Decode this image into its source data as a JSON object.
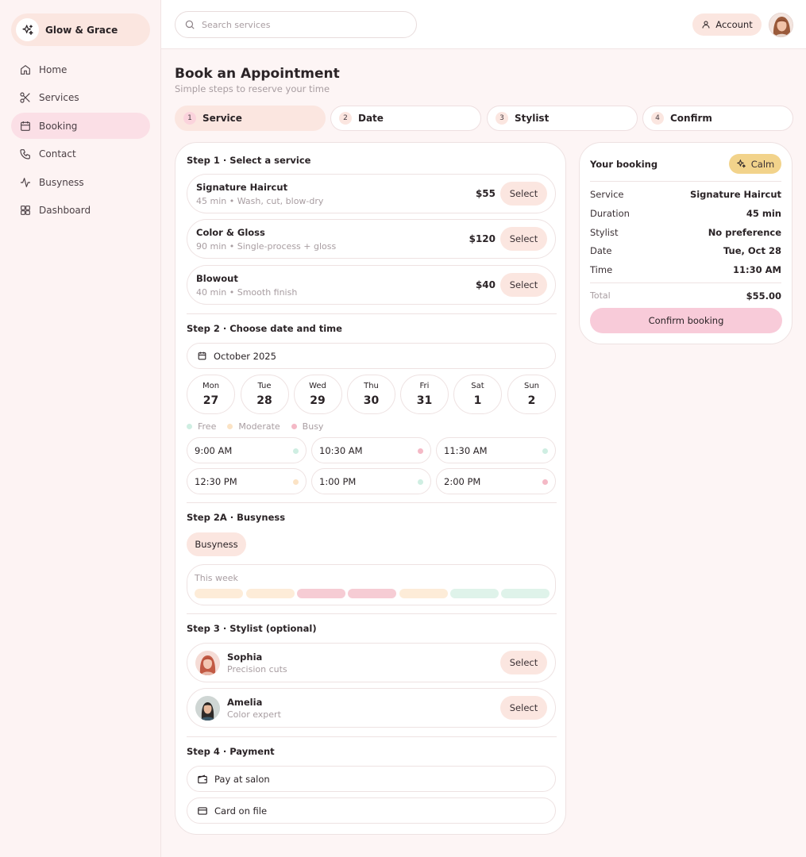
{
  "brand": {
    "name": "Glow & Grace"
  },
  "sidebar": {
    "items": [
      {
        "label": "Home",
        "icon": "home-icon"
      },
      {
        "label": "Services",
        "icon": "scissors-icon"
      },
      {
        "label": "Booking",
        "icon": "calendar-icon",
        "active": true
      },
      {
        "label": "Contact",
        "icon": "phone-icon"
      },
      {
        "label": "Busyness",
        "icon": "activity-icon"
      },
      {
        "label": "Dashboard",
        "icon": "dashboard-icon"
      }
    ]
  },
  "topbar": {
    "search_placeholder": "Search services",
    "account_label": "Account"
  },
  "page": {
    "title": "Book an Appointment",
    "subtitle": "Simple steps to reserve your time"
  },
  "steps": [
    {
      "num": "1",
      "label": "Service",
      "active": true
    },
    {
      "num": "2",
      "label": "Date"
    },
    {
      "num": "3",
      "label": "Stylist"
    },
    {
      "num": "4",
      "label": "Confirm"
    }
  ],
  "step1": {
    "title": "Step 1 · Select a service",
    "services": [
      {
        "name": "Signature Haircut",
        "meta": "45 min • Wash, cut, blow-dry",
        "price": "$55",
        "button": "Select"
      },
      {
        "name": "Color & Gloss",
        "meta": "90 min • Single-process + gloss",
        "price": "$120",
        "button": "Select"
      },
      {
        "name": "Blowout",
        "meta": "40 min • Smooth finish",
        "price": "$40",
        "button": "Select"
      }
    ]
  },
  "step2": {
    "title": "Step 2 · Choose date and time",
    "month": "October 2025",
    "days": [
      {
        "name": "Mon",
        "num": "27"
      },
      {
        "name": "Tue",
        "num": "28"
      },
      {
        "name": "Wed",
        "num": "29"
      },
      {
        "name": "Thu",
        "num": "30"
      },
      {
        "name": "Fri",
        "num": "31"
      },
      {
        "name": "Sat",
        "num": "1"
      },
      {
        "name": "Sun",
        "num": "2"
      }
    ],
    "legend": {
      "free": "Free",
      "moderate": "Moderate",
      "busy": "Busy"
    },
    "slots": [
      {
        "time": "9:00 AM",
        "level": "free"
      },
      {
        "time": "10:30 AM",
        "level": "busy"
      },
      {
        "time": "11:30 AM",
        "level": "free"
      },
      {
        "time": "12:30 PM",
        "level": "moderate"
      },
      {
        "time": "1:00 PM",
        "level": "free"
      },
      {
        "time": "2:00 PM",
        "level": "busy"
      }
    ]
  },
  "step2a": {
    "title": "Step 2A · Busyness",
    "chip": "Busyness",
    "week_label": "This week",
    "week_levels": [
      "moderate",
      "moderate",
      "busy",
      "busy",
      "moderate",
      "free",
      "free"
    ]
  },
  "step3": {
    "title": "Step 3 · Stylist (optional)",
    "stylists": [
      {
        "name": "Sophia",
        "meta": "Precision cuts",
        "button": "Select"
      },
      {
        "name": "Amelia",
        "meta": "Color expert",
        "button": "Select"
      }
    ]
  },
  "step4": {
    "title": "Step 4 · Payment",
    "options": [
      {
        "label": "Pay at salon",
        "icon": "wallet-icon"
      },
      {
        "label": "Card on file",
        "icon": "credit-card-icon"
      }
    ]
  },
  "summary": {
    "title": "Your booking",
    "mood": "Calm",
    "rows": [
      {
        "label": "Service",
        "value": "Signature Haircut"
      },
      {
        "label": "Duration",
        "value": "45 min"
      },
      {
        "label": "Stylist",
        "value": "No preference"
      },
      {
        "label": "Date",
        "value": "Tue, Oct 28"
      },
      {
        "label": "Time",
        "value": "11:30 AM"
      }
    ],
    "total_label": "Total",
    "total_value": "$55.00",
    "confirm_label": "Confirm booking"
  },
  "colors": {
    "free": "#dff3ea",
    "moderate": "#fdecd8",
    "busy": "#f6ccd4",
    "free_dot": "#cfeee2",
    "moderate_dot": "#fbe3c5",
    "busy_dot": "#f4b9c6"
  }
}
